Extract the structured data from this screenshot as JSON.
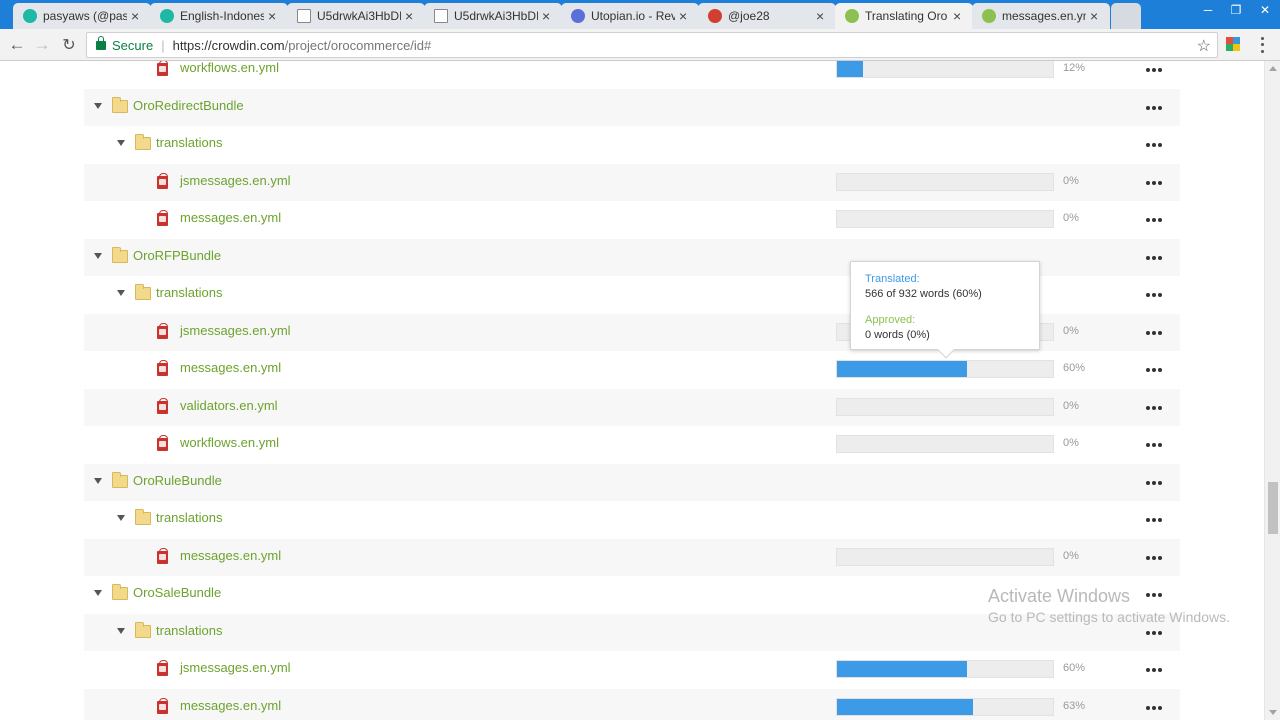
{
  "browser": {
    "tabs": [
      {
        "label": "pasyaws (@pasy",
        "icon_color": "#1db9a4",
        "active": false
      },
      {
        "label": "English-Indones",
        "icon_color": "#1db9a4",
        "active": false
      },
      {
        "label": "U5drwkAi3HbDI",
        "icon_color": "#ffffff",
        "active": false
      },
      {
        "label": "U5drwkAi3HbDI",
        "icon_color": "#ffffff",
        "active": false
      },
      {
        "label": "Utopian.io - Rev",
        "icon_color": "#5b6fd8",
        "active": false
      },
      {
        "label": "@joe28",
        "icon_color": "#d23f31",
        "active": false
      },
      {
        "label": "Translating Oro",
        "icon_color": "#8cc152",
        "active": true
      },
      {
        "label": "messages.en.ym",
        "icon_color": "#8cc152",
        "active": false
      }
    ],
    "secure_label": "Secure",
    "url_host": "https://crowdin.com",
    "url_path": "/project/orocommerce/id#"
  },
  "files": [
    {
      "type": "file",
      "name": "workflows.en.yml",
      "level": 2,
      "progress": 12,
      "pct": "12%"
    },
    {
      "type": "folder",
      "name": "OroRedirectBundle",
      "level": 0
    },
    {
      "type": "folder",
      "name": "translations",
      "level": 1
    },
    {
      "type": "file",
      "name": "jsmessages.en.yml",
      "level": 2,
      "progress": 0,
      "pct": "0%"
    },
    {
      "type": "file",
      "name": "messages.en.yml",
      "level": 2,
      "progress": 0,
      "pct": "0%"
    },
    {
      "type": "folder",
      "name": "OroRFPBundle",
      "level": 0
    },
    {
      "type": "folder",
      "name": "translations",
      "level": 1
    },
    {
      "type": "file",
      "name": "jsmessages.en.yml",
      "level": 2,
      "progress": 0,
      "pct": "0%"
    },
    {
      "type": "file",
      "name": "messages.en.yml",
      "level": 2,
      "progress": 60,
      "pct": "60%"
    },
    {
      "type": "file",
      "name": "validators.en.yml",
      "level": 2,
      "progress": 0,
      "pct": "0%"
    },
    {
      "type": "file",
      "name": "workflows.en.yml",
      "level": 2,
      "progress": 0,
      "pct": "0%"
    },
    {
      "type": "folder",
      "name": "OroRuleBundle",
      "level": 0
    },
    {
      "type": "folder",
      "name": "translations",
      "level": 1
    },
    {
      "type": "file",
      "name": "messages.en.yml",
      "level": 2,
      "progress": 0,
      "pct": "0%"
    },
    {
      "type": "folder",
      "name": "OroSaleBundle",
      "level": 0
    },
    {
      "type": "folder",
      "name": "translations",
      "level": 1
    },
    {
      "type": "file",
      "name": "jsmessages.en.yml",
      "level": 2,
      "progress": 60,
      "pct": "60%"
    },
    {
      "type": "file",
      "name": "messages.en.yml",
      "level": 2,
      "progress": 63,
      "pct": "63%"
    }
  ],
  "tooltip": {
    "translated_label": "Translated:",
    "translated_value": "566 of 932 words (60%)",
    "approved_label": "Approved:",
    "approved_value": "0 words (0%)"
  },
  "watermark": {
    "line1": "Activate Windows",
    "line2": "Go to PC settings to activate Windows."
  }
}
